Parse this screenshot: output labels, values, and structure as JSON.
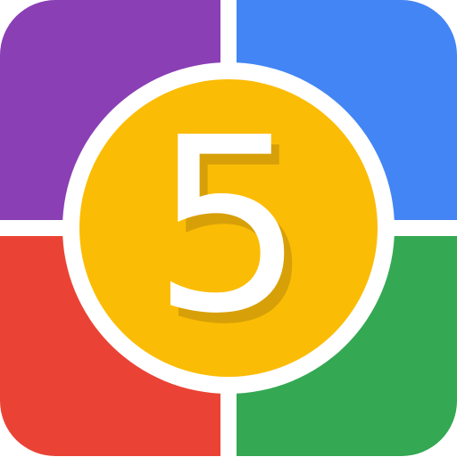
{
  "icon": {
    "digit": "5",
    "colors": {
      "top_left": "#8A3FB5",
      "top_right": "#4385F4",
      "bottom_left": "#EA4335",
      "bottom_right": "#34A853",
      "center": "#FBBC05",
      "ring": "#FFFFFF",
      "digit": "#FFFFFF",
      "digit_shadow": "#D7A008"
    }
  }
}
